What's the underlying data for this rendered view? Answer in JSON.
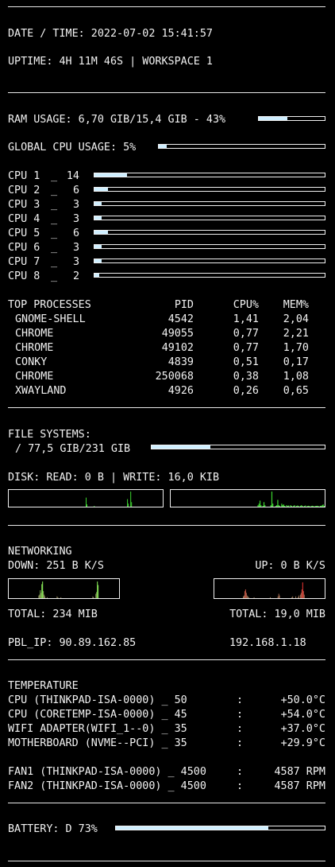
{
  "header": {
    "datetime": "DATE / TIME: 2022-07-02 15:41:57",
    "uptime": "UPTIME: 4H 11M 46S | WORKSPACE 1"
  },
  "ram": {
    "label": "RAM USAGE: 6,70 GIB/15,4 GIB - 43%",
    "percent": 43
  },
  "global_cpu": {
    "label": "GLOBAL CPU USAGE: 5%",
    "percent": 5
  },
  "cpus": [
    {
      "name": "CPU 1",
      "sep": "_",
      "value": "14",
      "percent": 14
    },
    {
      "name": "CPU 2",
      "sep": "_",
      "value": "6",
      "percent": 6
    },
    {
      "name": "CPU 3",
      "sep": "_",
      "value": "3",
      "percent": 3
    },
    {
      "name": "CPU 4",
      "sep": "_",
      "value": "3",
      "percent": 3
    },
    {
      "name": "CPU 5",
      "sep": "_",
      "value": "6",
      "percent": 6
    },
    {
      "name": "CPU 6",
      "sep": "_",
      "value": "3",
      "percent": 3
    },
    {
      "name": "CPU 7",
      "sep": "_",
      "value": "3",
      "percent": 3
    },
    {
      "name": "CPU 8",
      "sep": "_",
      "value": "2",
      "percent": 2
    }
  ],
  "processes": {
    "headers": {
      "name": "TOP PROCESSES",
      "pid": "PID",
      "cpu": "CPU%",
      "mem": "MEM%"
    },
    "rows": [
      {
        "name": "GNOME-SHELL",
        "pid": "4542",
        "cpu": "1,41",
        "mem": "2,04"
      },
      {
        "name": "CHROME",
        "pid": "49055",
        "cpu": "0,77",
        "mem": "2,21"
      },
      {
        "name": "CHROME",
        "pid": "49102",
        "cpu": "0,77",
        "mem": "1,70"
      },
      {
        "name": "CONKY",
        "pid": "4839",
        "cpu": "0,51",
        "mem": "0,17"
      },
      {
        "name": "CHROME",
        "pid": "250068",
        "cpu": "0,38",
        "mem": "1,08"
      },
      {
        "name": "XWAYLAND",
        "pid": "4926",
        "cpu": "0,26",
        "mem": "0,65"
      }
    ]
  },
  "filesystems": {
    "title": "FILE SYSTEMS:",
    "root": "/ 77,5 GIB/231 GIB",
    "root_percent": 34,
    "disk_io": "DISK: READ: 0 B | WRITE: 16,0 KIB",
    "read_graph": [
      0,
      0,
      0,
      0,
      0,
      0,
      0,
      0,
      0,
      0,
      0,
      0,
      0,
      0,
      0,
      0,
      0,
      0,
      0,
      0,
      0,
      0,
      0,
      0,
      0,
      0,
      0,
      0,
      0,
      0,
      0,
      0,
      0,
      0,
      0,
      0,
      0,
      0,
      0,
      0,
      0,
      0,
      0,
      0,
      0,
      0,
      0,
      0,
      0,
      0,
      0,
      0,
      0,
      0,
      0,
      0,
      0,
      0,
      0,
      0,
      0,
      0,
      0,
      0,
      0,
      0,
      0,
      0,
      0,
      0,
      0,
      0,
      0,
      0,
      0,
      0,
      0,
      0,
      0,
      0,
      0,
      0,
      0,
      0,
      0,
      0,
      0,
      0,
      0,
      0,
      0,
      0,
      0,
      0,
      0,
      0.6,
      0.15,
      0,
      0,
      0,
      0,
      0,
      0,
      0,
      0,
      0.05,
      0,
      0,
      0,
      0,
      0,
      0,
      0,
      0,
      0,
      0,
      0,
      0,
      0,
      0,
      0,
      0,
      0,
      0,
      0,
      0,
      0,
      0,
      0,
      0,
      0,
      0,
      0,
      0,
      0,
      0,
      0,
      0,
      0,
      0,
      0,
      0,
      0,
      0,
      0,
      0,
      0.5,
      0.2,
      0,
      0,
      1.0,
      0.3,
      0,
      0,
      0,
      0,
      0,
      0,
      0,
      0,
      0,
      0,
      0,
      0,
      0,
      0,
      0,
      0,
      0,
      0,
      0,
      0,
      0,
      0,
      0,
      0,
      0,
      0,
      0,
      0,
      0,
      0,
      0,
      0,
      0,
      0,
      0,
      0,
      0,
      0
    ],
    "write_graph": [
      0,
      0,
      0,
      0,
      0,
      0,
      0,
      0,
      0,
      0,
      0,
      0,
      0,
      0,
      0,
      0,
      0,
      0,
      0,
      0,
      0,
      0,
      0,
      0,
      0,
      0,
      0,
      0,
      0,
      0,
      0,
      0,
      0,
      0,
      0,
      0,
      0,
      0,
      0,
      0,
      0,
      0,
      0,
      0,
      0,
      0,
      0,
      0,
      0,
      0,
      0,
      0,
      0,
      0,
      0,
      0,
      0,
      0,
      0,
      0,
      0,
      0,
      0,
      0,
      0,
      0,
      0,
      0,
      0,
      0,
      0,
      0,
      0,
      0,
      0,
      0,
      0,
      0,
      0,
      0,
      0,
      0,
      0,
      0,
      0,
      0,
      0,
      0,
      0.1,
      0.2,
      0.4,
      0.1,
      0,
      0.05,
      0.3,
      0.1,
      0,
      0,
      0,
      0,
      0,
      0.1,
      1.0,
      0.2,
      0,
      0,
      0.05,
      0.1,
      0.45,
      0.1,
      0.05,
      0,
      0.2,
      0.1,
      0.15,
      0.05,
      0,
      0.1,
      0.05,
      0.08,
      0,
      0.1,
      0.05,
      0,
      0.06,
      0.1,
      0,
      0.05,
      0.08,
      0.05,
      0,
      0.06,
      0.1,
      0.04,
      0,
      0.05,
      0.08,
      0,
      0.05,
      0.06,
      0.03,
      0,
      0.04,
      0.06,
      0.05,
      0,
      0.05,
      0.04,
      0.06,
      0.05,
      0,
      0.06,
      0.05,
      0.1,
      0.15,
      0.05
    ]
  },
  "network": {
    "title": "NETWORKING",
    "down": "DOWN: 251 B K/S",
    "up": "UP: 0 B K/S",
    "down_graph": [
      0,
      0,
      0,
      0,
      0,
      0,
      0,
      0,
      0,
      0,
      0,
      0,
      0,
      0,
      0,
      0,
      0,
      0,
      0,
      0,
      0,
      0,
      0,
      0,
      0,
      0,
      0,
      0,
      0,
      0,
      0,
      0,
      0,
      0,
      0,
      0,
      0,
      0,
      0,
      0.15,
      0.2,
      0.45,
      0.3,
      0.8,
      0.95,
      0.4,
      0.2,
      0.1,
      0,
      0,
      0.05,
      0,
      0,
      0,
      0,
      0,
      0,
      0,
      0,
      0,
      0,
      0,
      0,
      0.1,
      0.05,
      0,
      0,
      0,
      0.05,
      0,
      0,
      0,
      0,
      0,
      0,
      0,
      0,
      0,
      0,
      0,
      0,
      0,
      0,
      0,
      0,
      0,
      0,
      0,
      0,
      0,
      0,
      0,
      0,
      0,
      0,
      0,
      0,
      0,
      0,
      0,
      0,
      0,
      0,
      0,
      0,
      0,
      0,
      0,
      0,
      0,
      0.1,
      0.05,
      0,
      0,
      0.25,
      0.35,
      0.95,
      0.75,
      0,
      0,
      0,
      0,
      0,
      0,
      0,
      0,
      0,
      0,
      0,
      0,
      0,
      0,
      0,
      0,
      0,
      0,
      0,
      0,
      0,
      0,
      0,
      0,
      0,
      0,
      0
    ],
    "up_graph": [
      0,
      0,
      0,
      0,
      0,
      0,
      0,
      0,
      0,
      0,
      0,
      0,
      0,
      0,
      0,
      0,
      0,
      0,
      0,
      0,
      0,
      0,
      0,
      0,
      0,
      0,
      0,
      0,
      0,
      0,
      0,
      0,
      0,
      0,
      0,
      0,
      0,
      0.1,
      0.15,
      0.4,
      0.5,
      0.3,
      0.15,
      0.1,
      0.05,
      0,
      0,
      0,
      0,
      0,
      0,
      0.05,
      0,
      0,
      0,
      0,
      0,
      0,
      0,
      0,
      0,
      0,
      0,
      0,
      0,
      0,
      0,
      0,
      0,
      0,
      0,
      0,
      0.05,
      0,
      0,
      0,
      0,
      0,
      0,
      0,
      0,
      0,
      0.1,
      0.25,
      0.15,
      0,
      0,
      0,
      0,
      0,
      0,
      0,
      0,
      0,
      0,
      0,
      0,
      0,
      0,
      0,
      0.05,
      0.1,
      0,
      0,
      0,
      0.1,
      0,
      0,
      0.05,
      0.15,
      0,
      0.2,
      0.3,
      0.5,
      0.9,
      0.4,
      0.2,
      0,
      0,
      0,
      0,
      0,
      0,
      0,
      0,
      0,
      0,
      0,
      0,
      0,
      0,
      0,
      0,
      0,
      0,
      0,
      0,
      0,
      0,
      0,
      0,
      0,
      0
    ],
    "total_down": "TOTAL: 234 MIB",
    "total_up": "TOTAL: 19,0 MIB",
    "public_ip": "PBL_IP: 90.89.162.85",
    "local_ip": "192.168.1.18"
  },
  "temperature": {
    "title": "TEMPERATURE",
    "sensors": [
      {
        "label": "CPU (THINKPAD-ISA-0000) _ 50",
        "sep": ":",
        "value": "+50.0°C"
      },
      {
        "label": "CPU (CORETEMP-ISA-0000) _ 45",
        "sep": ":",
        "value": "+54.0°C"
      },
      {
        "label": "WIFI ADAPTER(WIFI_1--0) _ 35",
        "sep": ":",
        "value": "+37.0°C"
      },
      {
        "label": "MOTHERBOARD (NVME--PCI) _ 35",
        "sep": ":",
        "value": "+29.9°C"
      }
    ],
    "fans": [
      {
        "label": "FAN1 (THINKPAD-ISA-0000) _ 4500",
        "sep": ":",
        "value": "4587 RPM"
      },
      {
        "label": "FAN2 (THINKPAD-ISA-0000) _ 4500",
        "sep": ":",
        "value": "4587 RPM"
      }
    ]
  },
  "battery": {
    "label": "BATTERY: D 73%",
    "percent": 73
  },
  "colors": {
    "background": "#000000",
    "text": "#f2f2f2",
    "bar_fill": "#cfefff",
    "disk_graph": "#3bd12e",
    "net_down_start": "#8a7a5a",
    "net_down_end": "#8cff5a",
    "net_up_start": "#8a7a5a",
    "net_up_end": "#ff3030"
  }
}
